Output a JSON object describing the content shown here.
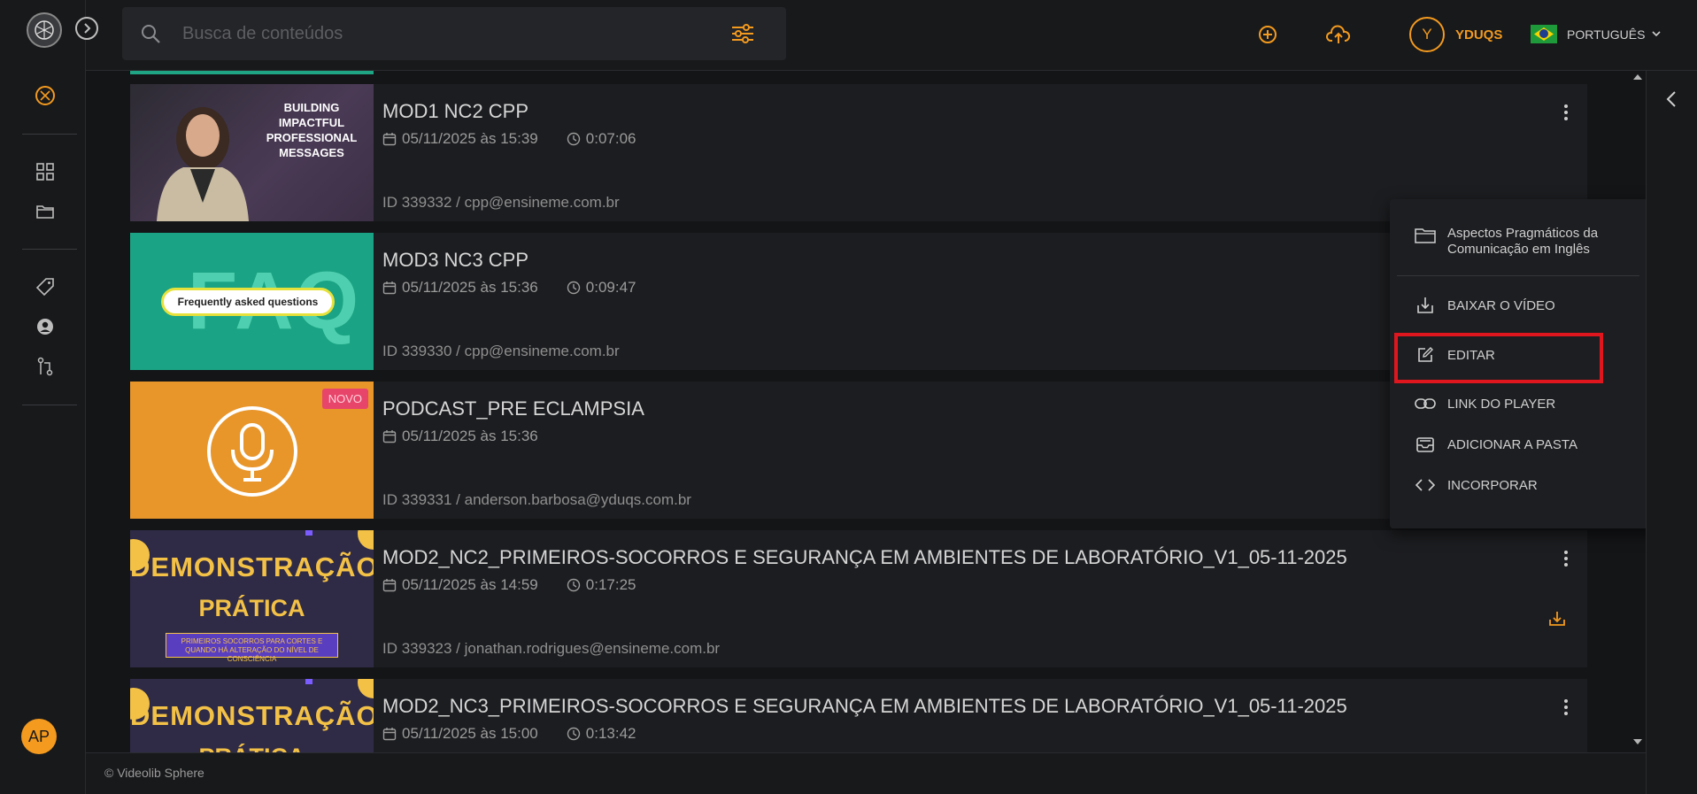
{
  "search": {
    "placeholder": "Busca de conteúdos"
  },
  "user": {
    "initial": "Y",
    "name": "YDUQS"
  },
  "language": {
    "label": "PORTUGUÊS"
  },
  "account": {
    "initials": "AP"
  },
  "videos": [
    {
      "title": "MOD1 NC2 CPP",
      "date": "05/11/2025 às 15:39",
      "duration": "0:07:06",
      "id_line": "ID 339332 / cpp@ensineme.com.br",
      "thumb_text": "BUILDING IMPACTFUL PROFESSIONAL MESSAGES"
    },
    {
      "title": "MOD3 NC3 CPP",
      "date": "05/11/2025 às 15:36",
      "duration": "0:09:47",
      "id_line": "ID 339330 / cpp@ensineme.com.br",
      "thumb_big": "FAQ",
      "thumb_pill": "Frequently asked questions"
    },
    {
      "title": "PODCAST_PRE ECLAMPSIA",
      "date": "05/11/2025 às 15:36",
      "id_line": "ID 339331 / anderson.barbosa@yduqs.com.br",
      "badge": "NOVO"
    },
    {
      "title": "MOD2_NC2_PRIMEIROS-SOCORROS E SEGURANÇA EM AMBIENTES DE LABORATÓRIO_V1_05-11-2025",
      "date": "05/11/2025 às 14:59",
      "duration": "0:17:25",
      "id_line": "ID 339323 / jonathan.rodrigues@ensineme.com.br",
      "thumb_h1": "DEMONSTRAÇÃO",
      "thumb_h2": "PRÁTICA",
      "thumb_box": "PRIMEIROS SOCORROS PARA CORTES E QUANDO HÁ ALTERAÇÃO DO NÍVEL DE CONSCIÊNCIA"
    },
    {
      "title": "MOD2_NC3_PRIMEIROS-SOCORROS E SEGURANÇA EM AMBIENTES DE LABORATÓRIO_V1_05-11-2025",
      "date": "05/11/2025 às 15:00",
      "duration": "0:13:42",
      "thumb_h1": "DEMONSTRAÇÃO",
      "thumb_h2": "PRÁTICA"
    }
  ],
  "menu": {
    "folder": "Aspectos Pragmáticos da Comunicação em Inglês",
    "items": [
      "BAIXAR O VÍDEO",
      "EDITAR",
      "LINK DO PLAYER",
      "ADICIONAR A PASTA",
      "INCORPORAR"
    ]
  },
  "footer": "© Videolib Sphere",
  "colors": {
    "accent": "#f39a1f",
    "background": "#141517",
    "highlight": "#e0161f"
  }
}
